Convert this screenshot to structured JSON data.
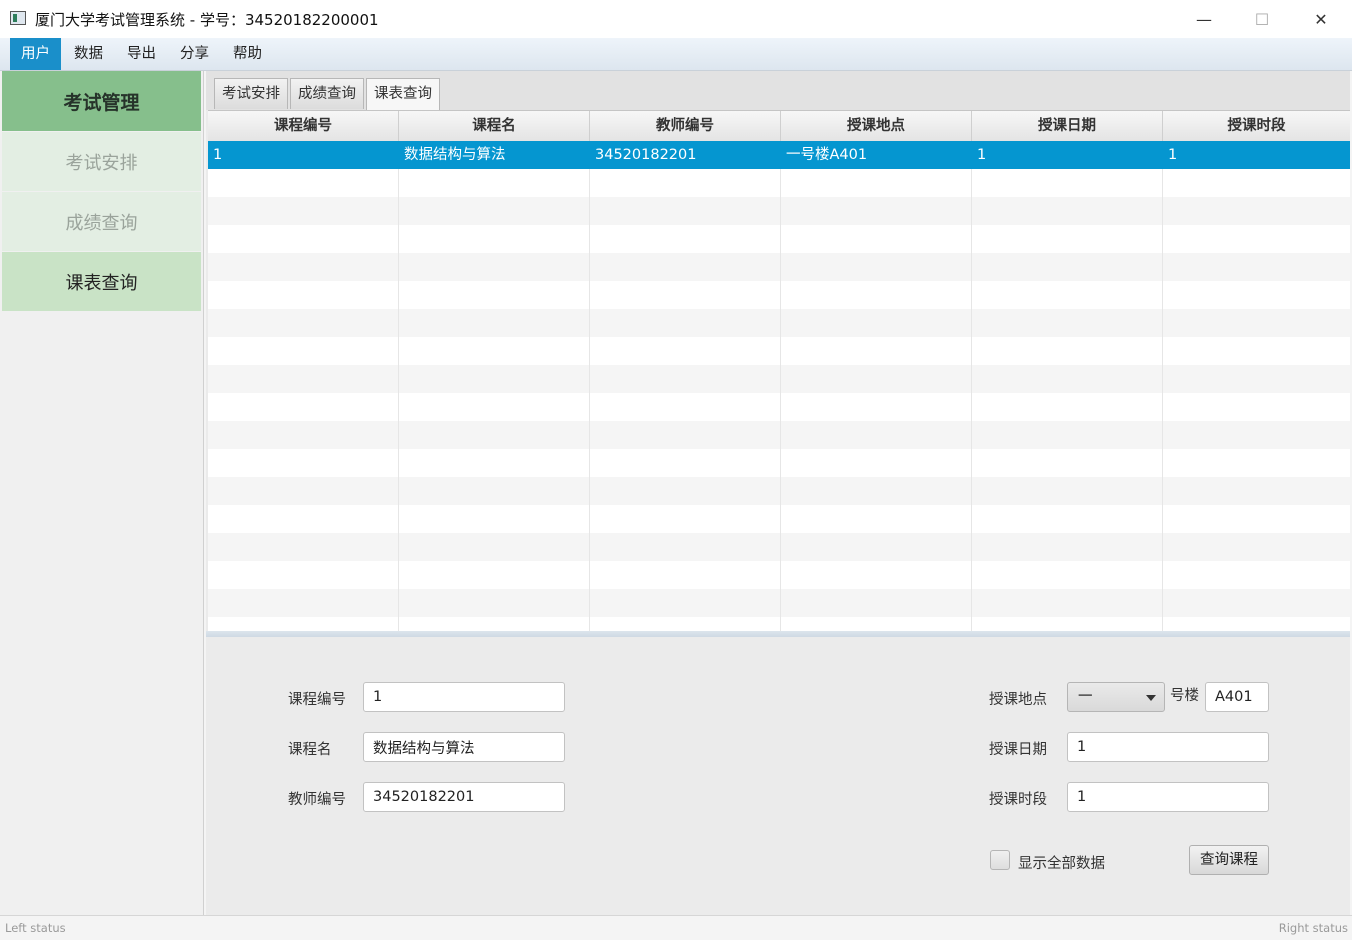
{
  "window": {
    "title": "厦门大学考试管理系统 - 学号：34520182200001",
    "minimize_glyph": "—",
    "maximize_glyph": "☐",
    "close_glyph": "✕"
  },
  "menu": [
    "用户",
    "数据",
    "导出",
    "分享",
    "帮助"
  ],
  "sidebar": {
    "header": "考试管理",
    "items": [
      "考试安排",
      "成绩查询",
      "课表查询"
    ],
    "selected": "课表查询"
  },
  "tabs": [
    "考试安排",
    "成绩查询",
    "课表查询"
  ],
  "active_tab": "课表查询",
  "table": {
    "columns": [
      "课程编号",
      "课程名",
      "教师编号",
      "授课地点",
      "授课日期",
      "授课时段"
    ],
    "rows": [
      [
        "1",
        "数据结构与算法",
        "34520182201",
        "一号楼A401",
        "1",
        "1"
      ]
    ],
    "selected_row": 0
  },
  "form": {
    "course_id_label": "课程编号",
    "course_id_value": "1",
    "course_name_label": "课程名",
    "course_name_value": "数据结构与算法",
    "teacher_id_label": "教师编号",
    "teacher_id_value": "34520182201",
    "location_label": "授课地点",
    "building_value": "一",
    "building_suffix": "号楼",
    "room_value": "A401",
    "date_label": "授课日期",
    "date_value": "1",
    "period_label": "授课时段",
    "period_value": "1",
    "show_all_label": "显示全部数据",
    "show_all_checked": false,
    "query_button": "查询课程"
  },
  "status": {
    "left": "Left status",
    "right": "Right status"
  },
  "colors": {
    "accent": "#0596d0",
    "sidebar_header": "#86bf8c",
    "sidebar_selected": "#c9e3c6"
  }
}
